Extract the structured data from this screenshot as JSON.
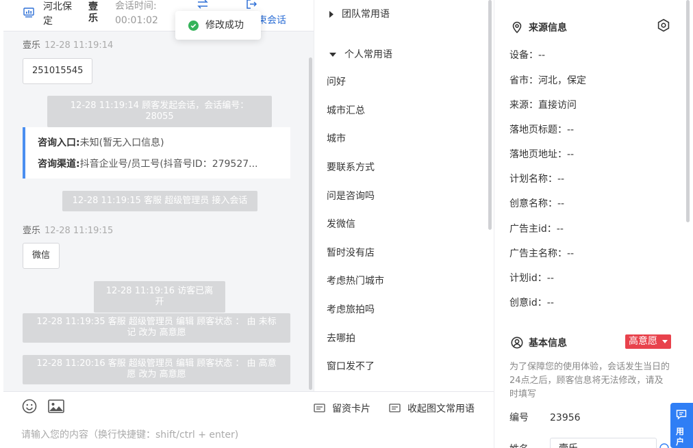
{
  "header": {
    "city": "河北保定",
    "visitor_name": "壹乐",
    "time_label": "会话时间:",
    "time_value": "00:01:02",
    "end_label": "束会话"
  },
  "toast": {
    "text": "修改成功"
  },
  "chat": {
    "messages": [
      {
        "sender": "壹乐",
        "time": "12-28 11:19:14",
        "text": "251015545"
      },
      {
        "sender": "壹乐",
        "time": "12-28 11:19:15",
        "text": "微信"
      }
    ],
    "system": [
      "12-28 11:19:14 顾客发起会话，会话编号：28055",
      "12-28 11:19:15 客服 超级管理员 接入会话",
      "12-28 11:19:16 访客已离开",
      "12-28 11:19:35 客服 超级管理员 编辑 顾客状态 ： 由 未标记 改为 高意愿",
      "12-28 11:20:16 客服 超级管理员 编辑 顾客状态 ： 由 高意愿 改为 高意愿"
    ],
    "entry_card": {
      "entry_label": "咨询入口:",
      "entry_value": "未知(暂无入口信息)",
      "channel_label": "咨询渠道:",
      "channel_value": "抖音企业号/员工号(抖音号ID：279527..."
    }
  },
  "compose": {
    "card_label": "留资卡片",
    "collapse_label": "收起图文常用语",
    "placeholder": "请输入您的内容（换行快捷键：shift/ctrl + enter)"
  },
  "phrases": {
    "team_group": "团队常用语",
    "personal_group": "个人常用语",
    "items": [
      "问好",
      "城市汇总",
      "城市",
      "要联系方式",
      "问是咨询吗",
      "发微信",
      "暂时没有店",
      "考虑热门城市",
      "考虑旅拍吗",
      "去哪拍",
      "窗口发不了"
    ]
  },
  "info": {
    "source_title": "来源信息",
    "source_rows": [
      "设备：--",
      "省市：河北，保定",
      "来源：直接访问",
      "落地页标题：--",
      "落地页地址：--",
      "计划名称：--",
      "创意名称：--",
      "广告主id：--",
      "广告主名称：--",
      "计划id：--",
      "创意id：--"
    ],
    "basic_title": "基本信息",
    "status_badge": "高意愿",
    "notice": "为了保障您的使用体验，会话发生当日的24点之后，顾客信息将无法修改，请及时填写",
    "id_label": "编号",
    "id_value": "23956",
    "name_label": "姓名",
    "name_value": "壹乐"
  },
  "float_tab": {
    "label": "用户"
  },
  "colors": {
    "accent": "#2f7ef5",
    "badge": "#e8424c",
    "success": "#35b35a",
    "system_bg": "#d7d8da"
  }
}
